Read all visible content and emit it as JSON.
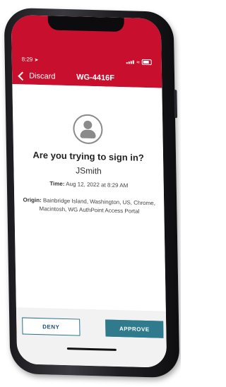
{
  "status_bar": {
    "time": "8:29"
  },
  "header": {
    "back_label": "Discard",
    "device_title": "WG-4416F",
    "color": "#c8102e"
  },
  "prompt": {
    "question": "Are you trying to sign in?",
    "username": "JSmith",
    "time_label": "Time:",
    "time_value": " Aug 12, 2022 at 8:29 AM",
    "origin_label": "Origin:",
    "origin_value": " Bainbridge Island, Washington, US, Chrome, Macintosh, WG AuthPoint Access Portal"
  },
  "actions": {
    "deny_label": "DENY",
    "approve_label": "APPROVE",
    "approve_color": "#2f7a8c"
  },
  "icons": {
    "avatar": "user-circle-icon",
    "back": "chevron-left-icon",
    "location": "location-arrow-icon",
    "signal": "signal-icon",
    "wifi": "wifi-icon",
    "battery": "battery-icon"
  }
}
